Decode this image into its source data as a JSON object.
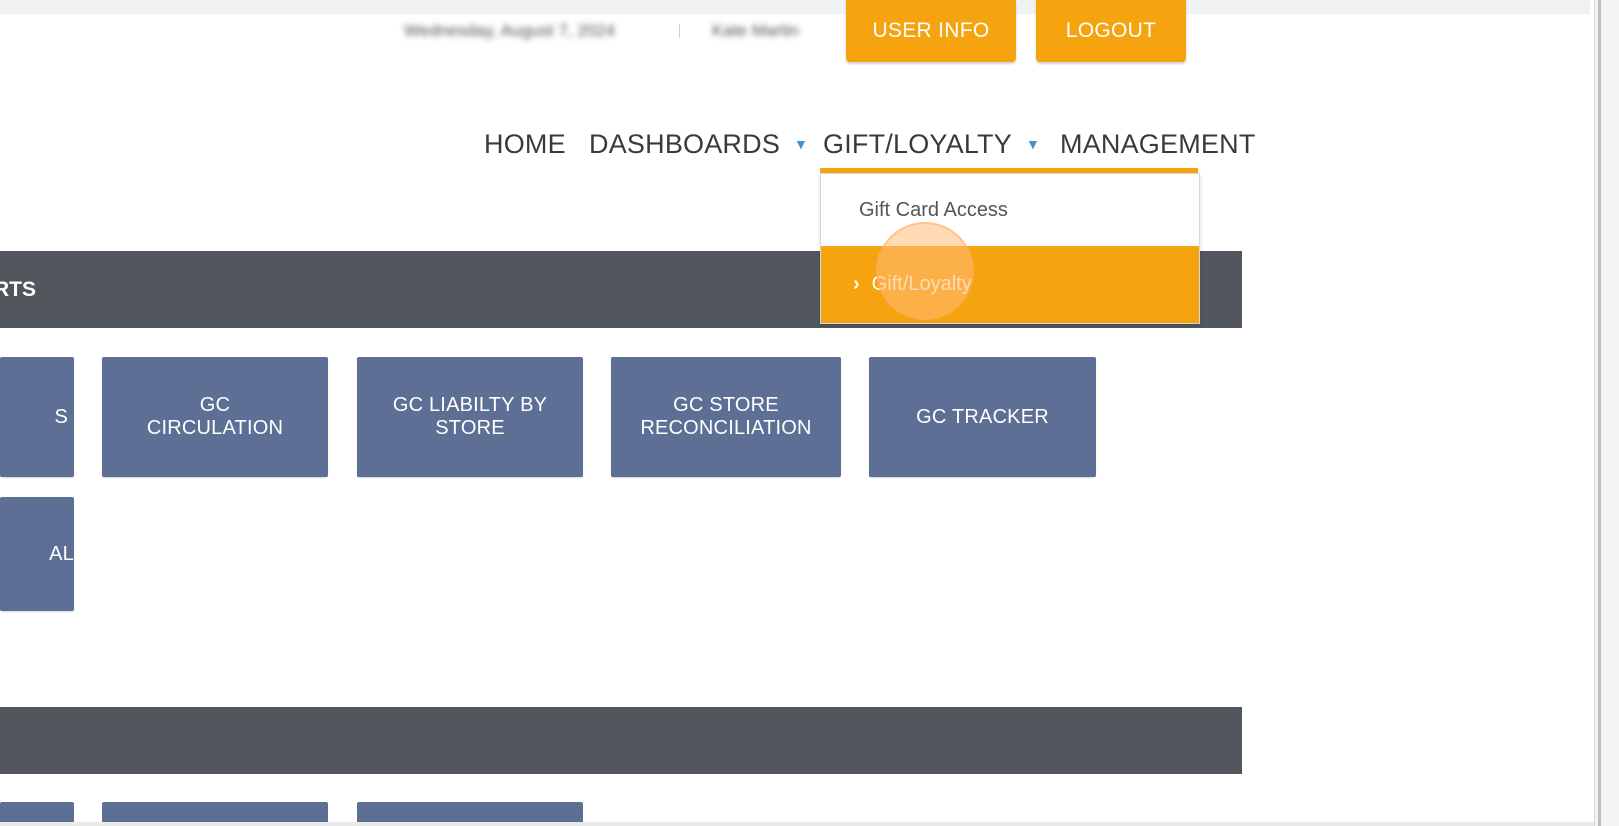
{
  "header": {
    "date": "Wednesday, August 7, 2024",
    "user_name": "Kate Martin",
    "user_info_label": "USER INFO",
    "logout_label": "LOGOUT"
  },
  "nav": {
    "home": "HOME",
    "dashboards": "DASHBOARDS",
    "gift_loyalty": "GIFT/LOYALTY",
    "management": "MANAGEMENT"
  },
  "dropdown": {
    "items": [
      {
        "label": "Gift Card Access"
      },
      {
        "label": "Gift/Loyalty",
        "active": true
      }
    ]
  },
  "sections": {
    "reports_title": "REPORTS"
  },
  "tiles": {
    "left_partial_1": "S",
    "left_partial_2": "MANUAL",
    "items": [
      {
        "line1": "GC",
        "line2": "CIRCULATION"
      },
      {
        "line1": "GC LIABILTY BY",
        "line2": "STORE"
      },
      {
        "line1": "GC STORE",
        "line2": "RECONCILIATION"
      },
      {
        "line1": "GC TRACKER"
      }
    ]
  },
  "colors": {
    "accent": "#f5a30f",
    "section_bar": "#51575d",
    "tile": "#5d6f95",
    "caret": "#3f8fd2"
  },
  "icons": {
    "nav_caret": "chevron-down-icon",
    "dropdown_active": "chevron-right-icon"
  }
}
